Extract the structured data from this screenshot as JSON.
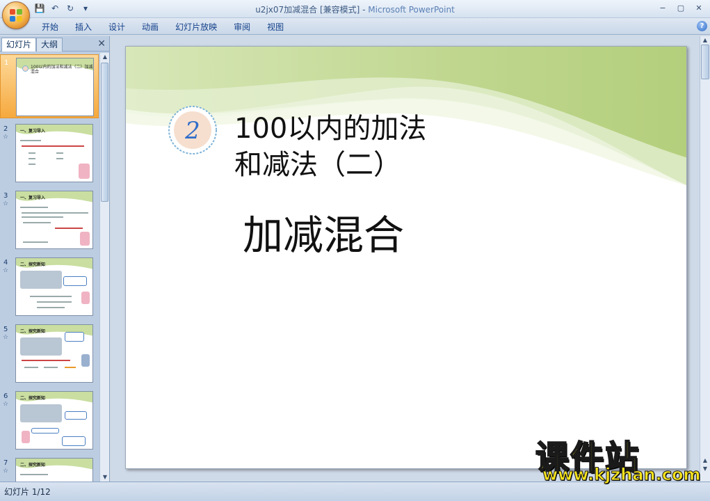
{
  "window": {
    "title_doc": "u2jx07加减混合 [兼容模式]",
    "title_sep": " - ",
    "title_app": "Microsoft PowerPoint",
    "minimize": "−",
    "maximize": "▢",
    "close": "✕"
  },
  "qat": {
    "save": "💾",
    "undo": "↶",
    "redo": "↻",
    "more": "▾"
  },
  "ribbon": {
    "tabs": [
      "开始",
      "插入",
      "设计",
      "动画",
      "幻灯片放映",
      "审阅",
      "视图"
    ],
    "help": "?"
  },
  "pane": {
    "tab_slides": "幻灯片",
    "tab_outline": "大纲",
    "close": "✕",
    "slides": [
      {
        "num": "1",
        "star": "",
        "title": "100以内的加法和减法（二）加减混合"
      },
      {
        "num": "2",
        "star": "☆",
        "title": "一、复习导入"
      },
      {
        "num": "3",
        "star": "☆",
        "title": "一、复习导入"
      },
      {
        "num": "4",
        "star": "☆",
        "title": "二、探究新知"
      },
      {
        "num": "5",
        "star": "☆",
        "title": "二、探究新知"
      },
      {
        "num": "6",
        "star": "☆",
        "title": "二、探究新知"
      },
      {
        "num": "7",
        "star": "☆",
        "title": "二、探究新知"
      }
    ]
  },
  "slide": {
    "badge_number": "2",
    "title_line1": "100以内的加法",
    "title_line2": "和减法（二）",
    "subtitle": "加减混合"
  },
  "status": {
    "text": "幻灯片 1/12"
  },
  "watermark": {
    "big": "课件站",
    "url": "www.kjzhan.com"
  },
  "colors": {
    "accent_green": "#b9d38a",
    "selected_thumb": "#f6a93e",
    "ribbon_text": "#15428b",
    "watermark_yellow": "#f7e41c"
  }
}
